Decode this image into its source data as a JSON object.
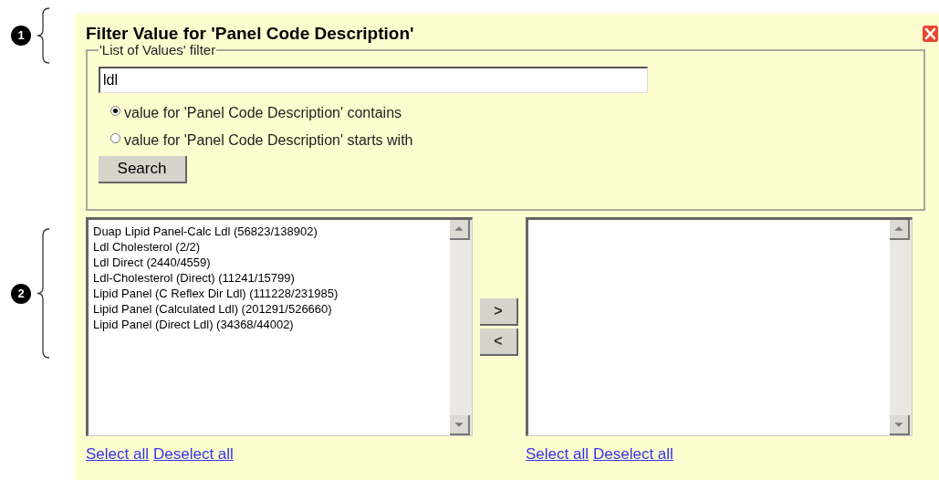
{
  "callouts": [
    {
      "label": "1"
    },
    {
      "label": "2"
    }
  ],
  "dialog": {
    "title": "Filter Value for 'Panel Code Description'"
  },
  "filter": {
    "legend": "'List of Values' filter",
    "value": "ldl",
    "options": [
      {
        "label": "value for 'Panel Code Description' contains",
        "selected": true
      },
      {
        "label": "value for 'Panel Code Description' starts with",
        "selected": false
      }
    ],
    "search_button": "Search"
  },
  "available_list": {
    "items": [
      "Duap Lipid Panel-Calc Ldl (56823/138902)",
      "Ldl Cholesterol (2/2)",
      "Ldl Direct (2440/4559)",
      "Ldl-Cholesterol (Direct) (11241/15799)",
      "Lipid Panel (C Reflex Dir Ldl) (111228/231985)",
      "Lipid Panel (Calculated Ldl) (201291/526660)",
      "Lipid Panel (Direct Ldl) (34368/44002)"
    ],
    "links": [
      "Select all",
      "Deselect all"
    ]
  },
  "move_buttons": [
    ">",
    "<"
  ],
  "selected_list": {
    "links": [
      "Select all",
      "Deselect all"
    ]
  }
}
